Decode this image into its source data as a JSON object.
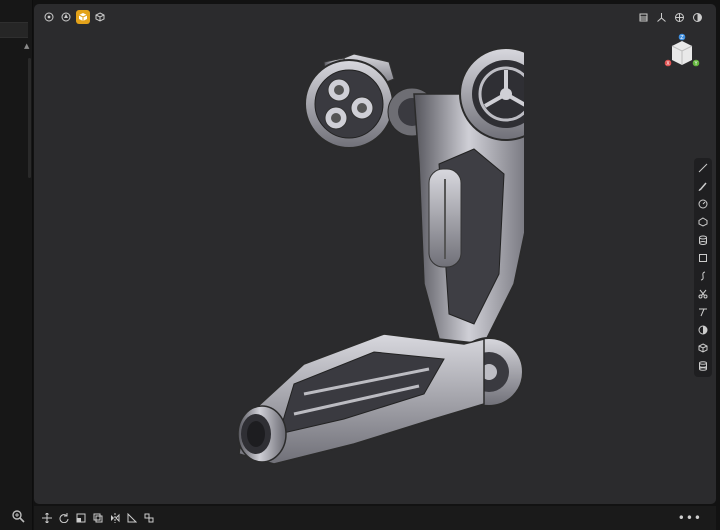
{
  "app": {
    "more_label": "•••"
  },
  "viewport": {
    "top_left_tools": [
      "settings-icon",
      "appearance-icon",
      "solid-view-icon",
      "wireframe-view-icon"
    ],
    "active_tool": "solid-view-icon",
    "top_right_tools": [
      "layers-icon",
      "axes-icon",
      "snap-icon",
      "display-mode-icon"
    ],
    "view_cube": {
      "z_axis": "Z",
      "x_axis": "X",
      "y_axis": "Y"
    }
  },
  "right_toolbar": {
    "tools": [
      "line-icon",
      "pen-icon",
      "circle-icon",
      "polygon-icon",
      "cylinder-icon",
      "rectangle-icon",
      "curve-icon",
      "scissors-icon",
      "trim-icon",
      "contrast-icon",
      "cube-icon",
      "database-icon"
    ]
  },
  "bottom_toolbar": {
    "tools": [
      "move-icon",
      "rotate-icon",
      "scale-icon",
      "copy-icon",
      "mirror-icon",
      "measure-icon",
      "array-icon"
    ]
  },
  "colors": {
    "accent": "#e3a21a",
    "viewport_bg": "#2b2b2d",
    "panel_bg": "#171717",
    "axis_x": "#e05252",
    "axis_y": "#63b53c",
    "axis_z": "#3f8fe0"
  }
}
